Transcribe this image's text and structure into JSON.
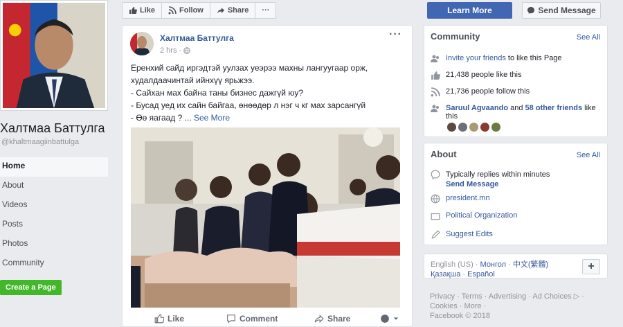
{
  "page": {
    "name": "Халтмаа Баттулга",
    "handle": "@khaltmaagiinbattulga"
  },
  "nav": [
    {
      "label": "Home"
    },
    {
      "label": "About"
    },
    {
      "label": "Videos"
    },
    {
      "label": "Posts"
    },
    {
      "label": "Photos"
    },
    {
      "label": "Community"
    }
  ],
  "create_page_label": "Create a Page",
  "toolbar": {
    "like_label": "Like",
    "follow_label": "Follow",
    "share_label": "Share",
    "more_label": "···",
    "learn_more_label": "Learn More",
    "send_message_label": "Send Message"
  },
  "post": {
    "author": "Халтмаа Баттулга",
    "time": "2 hrs ·",
    "menu": "···",
    "lines": [
      "Еренхий сайд иргэдтэй уулзах уеэрээ махны лангуугаар орж,",
      "худалдаачинтай ийнхүү ярьжээ.",
      "- Сайхан мах байна таны бизнес дажгүй юу?",
      "- Бусад уед их сайн байгаа, өнөөдөр л нэг ч кг мах зарсангүй",
      "- Өө яагаад ? ..."
    ],
    "see_more": "See More",
    "actions": {
      "like": "Like",
      "comment": "Comment",
      "share": "Share"
    }
  },
  "community": {
    "title": "Community",
    "see_all": "See All",
    "invite_link": "Invite your friends",
    "invite_rest": "to like this Page",
    "likes_text": "21,438 people like this",
    "follows_text": "21,736 people follow this",
    "friend_name": "Saruul Agvaando",
    "friend_and": "and",
    "friend_others": "58 other friends",
    "friend_rest": "like this"
  },
  "about": {
    "title": "About",
    "see_all": "See All",
    "replies": "Typically replies within minutes",
    "send_message": "Send Message",
    "website": "president.mn",
    "category": "Political Organization",
    "suggest_edits": "Suggest Edits"
  },
  "languages": {
    "current": "English (US)",
    "options": [
      "Монгол",
      "中文(繁體)",
      "Қазақша",
      "Español"
    ],
    "add": "+"
  },
  "footer": {
    "links": [
      "Privacy",
      "Terms",
      "Advertising",
      "Ad Choices",
      "Cookies",
      "More"
    ],
    "copyright": "Facebook © 2018"
  },
  "colors": {
    "link": "#365899",
    "primary": "#4267b2",
    "green": "#42b72a"
  }
}
